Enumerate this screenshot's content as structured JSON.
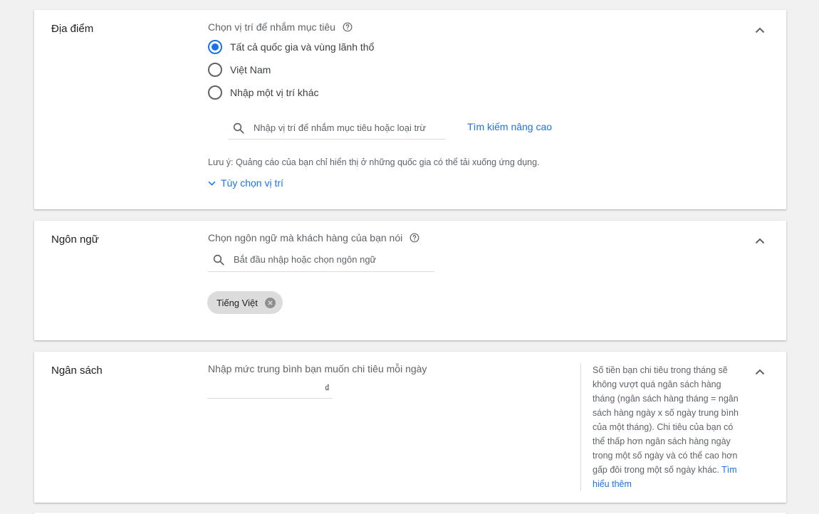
{
  "location": {
    "title": "Địa điểm",
    "prompt": "Chọn vị trí để nhắm mục tiêu",
    "options": [
      {
        "label": "Tất cả quốc gia và vùng lãnh thổ",
        "selected": true
      },
      {
        "label": "Việt Nam",
        "selected": false
      },
      {
        "label": "Nhập một vị trí khác",
        "selected": false
      }
    ],
    "search_placeholder": "Nhập vị trí để nhắm mục tiêu hoặc loại trừ",
    "advanced_search": "Tìm kiếm nâng cao",
    "note": "Lưu ý: Quảng cáo của bạn chỉ hiển thị ở những quốc gia có thể tải xuống ứng dụng.",
    "options_toggle": "Tùy chọn vị trí"
  },
  "language": {
    "title": "Ngôn ngữ",
    "prompt": "Chọn ngôn ngữ mà khách hàng của bạn nói",
    "search_placeholder": "Bắt đầu nhập hoặc chọn ngôn ngữ",
    "chips": [
      "Tiếng Việt"
    ]
  },
  "budget": {
    "title": "Ngân sách",
    "prompt": "Nhập mức trung bình bạn muốn chi tiêu mỗi ngày",
    "currency": "₫",
    "value": "",
    "side_note": "Số tiền bạn chi tiêu trong tháng sẽ không vượt quá ngân sách hàng tháng (ngân sách hàng tháng = ngân sách hàng ngày x số ngày trung bình của một tháng). Chi tiêu của bạn có thể thấp hơn ngân sách hàng ngày trong một số ngày và có thể cao hơn gấp đôi trong một số ngày khác.",
    "learn_more": "Tìm hiểu thêm"
  },
  "colors": {
    "accent": "#1a73e8",
    "background": "#f1f1f1"
  },
  "icons": [
    "help-icon",
    "search-icon",
    "chevron-up-icon",
    "chevron-down-icon",
    "close-icon"
  ]
}
